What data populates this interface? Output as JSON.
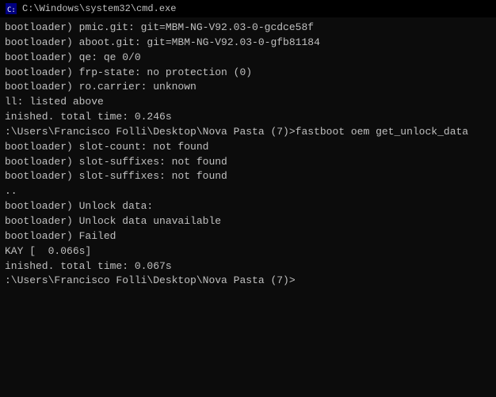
{
  "titleBar": {
    "icon": "cmd-icon",
    "title": "C:\\Windows\\system32\\cmd.exe"
  },
  "terminal": {
    "lines": [
      "bootloader) pmic.git: git=MBM-NG-V92.03-0-gcdce58f",
      "bootloader) aboot.git: git=MBM-NG-V92.03-0-gfb81184",
      "bootloader) qe: qe 0/0",
      "bootloader) frp-state: no protection (0)",
      "bootloader) ro.carrier: unknown",
      "ll: listed above",
      "inished. total time: 0.246s",
      "",
      ":\\Users\\Francisco Folli\\Desktop\\Nova Pasta (7)>fastboot oem get_unlock_data",
      "bootloader) slot-count: not found",
      "bootloader) slot-suffixes: not found",
      "bootloader) slot-suffixes: not found",
      "..",
      "",
      "bootloader) Unlock data:",
      "bootloader) Unlock data unavailable",
      "bootloader) Failed",
      "KAY [  0.066s]",
      "inished. total time: 0.067s",
      "",
      ":\\Users\\Francisco Folli\\Desktop\\Nova Pasta (7)>"
    ]
  }
}
